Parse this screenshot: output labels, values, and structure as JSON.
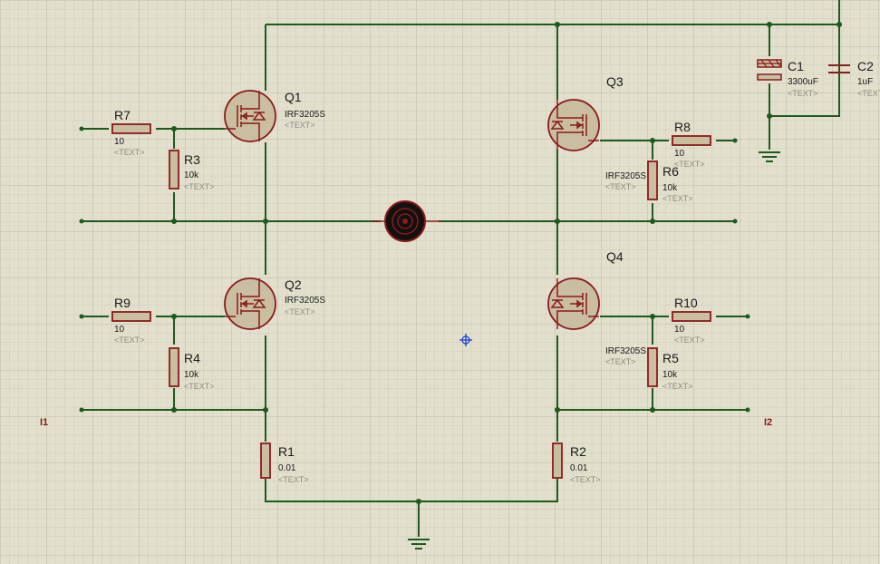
{
  "colors": {
    "background": "#e2e0cd",
    "grid_minor": "#cfcdb9",
    "grid_major": "#bdbba6",
    "wire": "#1e5a1e",
    "component_outline": "#8b1a1a",
    "component_fill": "#c9bea0",
    "placeholder_text": "#8c8c82"
  },
  "placeholder": "<TEXT>",
  "terminals": [
    {
      "id": "I1",
      "label": "I1"
    },
    {
      "id": "I2",
      "label": "I2"
    }
  ],
  "components": {
    "Q1": {
      "ref": "Q1",
      "value": "IRF3205S",
      "icon": "nmos-transistor-icon"
    },
    "Q2": {
      "ref": "Q2",
      "value": "IRF3205S",
      "icon": "nmos-transistor-icon"
    },
    "Q3": {
      "ref": "Q3",
      "value": "IRF3205S",
      "icon": "nmos-transistor-icon"
    },
    "Q4": {
      "ref": "Q4",
      "value": "IRF3205S",
      "icon": "nmos-transistor-icon"
    },
    "R1": {
      "ref": "R1",
      "value": "0.01"
    },
    "R2": {
      "ref": "R2",
      "value": "0.01"
    },
    "R3": {
      "ref": "R3",
      "value": "10k"
    },
    "R4": {
      "ref": "R4",
      "value": "10k"
    },
    "R5": {
      "ref": "R5",
      "value": "10k"
    },
    "R6": {
      "ref": "R6",
      "value": "10k"
    },
    "R7": {
      "ref": "R7",
      "value": "10"
    },
    "R8": {
      "ref": "R8",
      "value": "10"
    },
    "R9": {
      "ref": "R9",
      "value": "10"
    },
    "R10": {
      "ref": "R10",
      "value": "10"
    },
    "C1": {
      "ref": "C1",
      "value": "3300uF",
      "icon": "polarized-capacitor-icon"
    },
    "C2": {
      "ref": "C2",
      "value": "1uF",
      "icon": "capacitor-icon"
    },
    "MOTOR": {
      "icon": "motor-icon"
    }
  },
  "icons": {
    "ground": "ground-icon",
    "cursor": "crosshair-cursor-icon"
  }
}
